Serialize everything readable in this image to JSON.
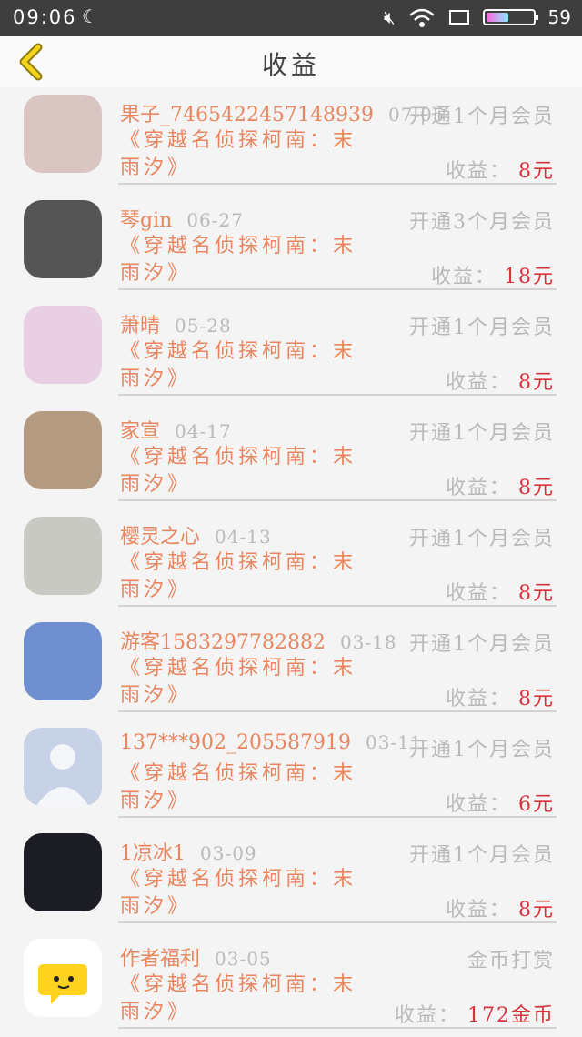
{
  "status": {
    "time": "09:06",
    "battery": "59"
  },
  "title": "收益",
  "items": [
    {
      "name": "果子_7465422457148939",
      "date": "07-05",
      "plan": "开通1个月会员",
      "book": "《穿越名侦探柯南：末雨汐》",
      "earn_label": "收益：",
      "amount": "8元",
      "avatar_color": "#d9c6c2"
    },
    {
      "name": "琴gin",
      "date": "06-27",
      "plan": "开通3个月会员",
      "book": "《穿越名侦探柯南：末雨汐》",
      "earn_label": "收益：",
      "amount": "18元",
      "avatar_color": "#555555"
    },
    {
      "name": "萧晴",
      "date": "05-28",
      "plan": "开通1个月会员",
      "book": "《穿越名侦探柯南：末雨汐》",
      "earn_label": "收益：",
      "amount": "8元",
      "avatar_color": "#e9cfe3"
    },
    {
      "name": "家宣",
      "date": "04-17",
      "plan": "开通1个月会员",
      "book": "《穿越名侦探柯南：末雨汐》",
      "earn_label": "收益：",
      "amount": "8元",
      "avatar_color": "#b59a82"
    },
    {
      "name": "樱灵之心",
      "date": "04-13",
      "plan": "开通1个月会员",
      "book": "《穿越名侦探柯南：末雨汐》",
      "earn_label": "收益：",
      "amount": "8元",
      "avatar_color": "#c9c9c4"
    },
    {
      "name": "游客1583297782882",
      "date": "03-18",
      "plan": "开通1个月会员",
      "book": "《穿越名侦探柯南：末雨汐》",
      "earn_label": "收益：",
      "amount": "8元",
      "avatar_color": "#6f8fd0"
    },
    {
      "name": "137***902_205587919",
      "date": "03-11",
      "plan": "开通1个月会员",
      "book": "《穿越名侦探柯南：末雨汐》",
      "earn_label": "收益：",
      "amount": "6元",
      "avatar_color": "#c7d2e6"
    },
    {
      "name": "1凉冰1",
      "date": "03-09",
      "plan": "开通1个月会员",
      "book": "《穿越名侦探柯南：末雨汐》",
      "earn_label": "收益：",
      "amount": "8元",
      "avatar_color": "#1c1c24"
    },
    {
      "name": "作者福利",
      "date": "03-05",
      "plan": "金币打赏",
      "book": "《穿越名侦探柯南：末雨汐》",
      "earn_label": "收益：",
      "amount": "172金币",
      "avatar_color": "#ffffff"
    }
  ]
}
